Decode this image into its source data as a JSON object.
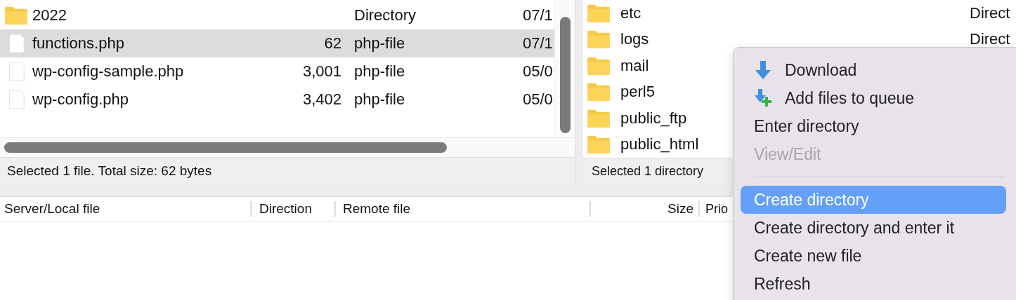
{
  "local_files": {
    "rows": [
      {
        "kind": "folder",
        "name": "2022",
        "size": "",
        "type": "Directory",
        "date": "07/1",
        "selected": false
      },
      {
        "kind": "file",
        "name": "functions.php",
        "size": "62",
        "type": "php-file",
        "date": "07/1",
        "selected": true
      },
      {
        "kind": "file",
        "name": "wp-config-sample.php",
        "size": "3,001",
        "type": "php-file",
        "date": "05/0",
        "selected": false
      },
      {
        "kind": "file",
        "name": "wp-config.php",
        "size": "3,402",
        "type": "php-file",
        "date": "05/0",
        "selected": false
      }
    ],
    "status": "Selected 1 file. Total size: 62 bytes"
  },
  "remote_files": {
    "rows": [
      {
        "name": "etc",
        "type": "Direct"
      },
      {
        "name": "logs",
        "type": "Direct"
      },
      {
        "name": "mail",
        "type": ""
      },
      {
        "name": "perl5",
        "type": ""
      },
      {
        "name": "public_ftp",
        "type": ""
      },
      {
        "name": "public_html",
        "type": ""
      }
    ],
    "status": "Selected 1 directory"
  },
  "queue": {
    "columns": [
      "Server/Local file",
      "Direction",
      "Remote file",
      "Size",
      "Prio"
    ]
  },
  "context_menu": {
    "items": [
      {
        "kind": "download",
        "label": "Download",
        "disabled": false,
        "selected": false
      },
      {
        "kind": "enqueue",
        "label": "Add files to queue",
        "disabled": false,
        "selected": false
      },
      {
        "kind": "plain",
        "label": "Enter directory",
        "disabled": false,
        "selected": false
      },
      {
        "kind": "plain",
        "label": "View/Edit",
        "disabled": true,
        "selected": false
      },
      {
        "kind": "separator"
      },
      {
        "kind": "plain",
        "label": "Create directory",
        "disabled": false,
        "selected": true
      },
      {
        "kind": "plain",
        "label": "Create directory and enter it",
        "disabled": false,
        "selected": false
      },
      {
        "kind": "plain",
        "label": "Create new file",
        "disabled": false,
        "selected": false
      },
      {
        "kind": "plain",
        "label": "Refresh",
        "disabled": false,
        "selected": false
      }
    ]
  }
}
